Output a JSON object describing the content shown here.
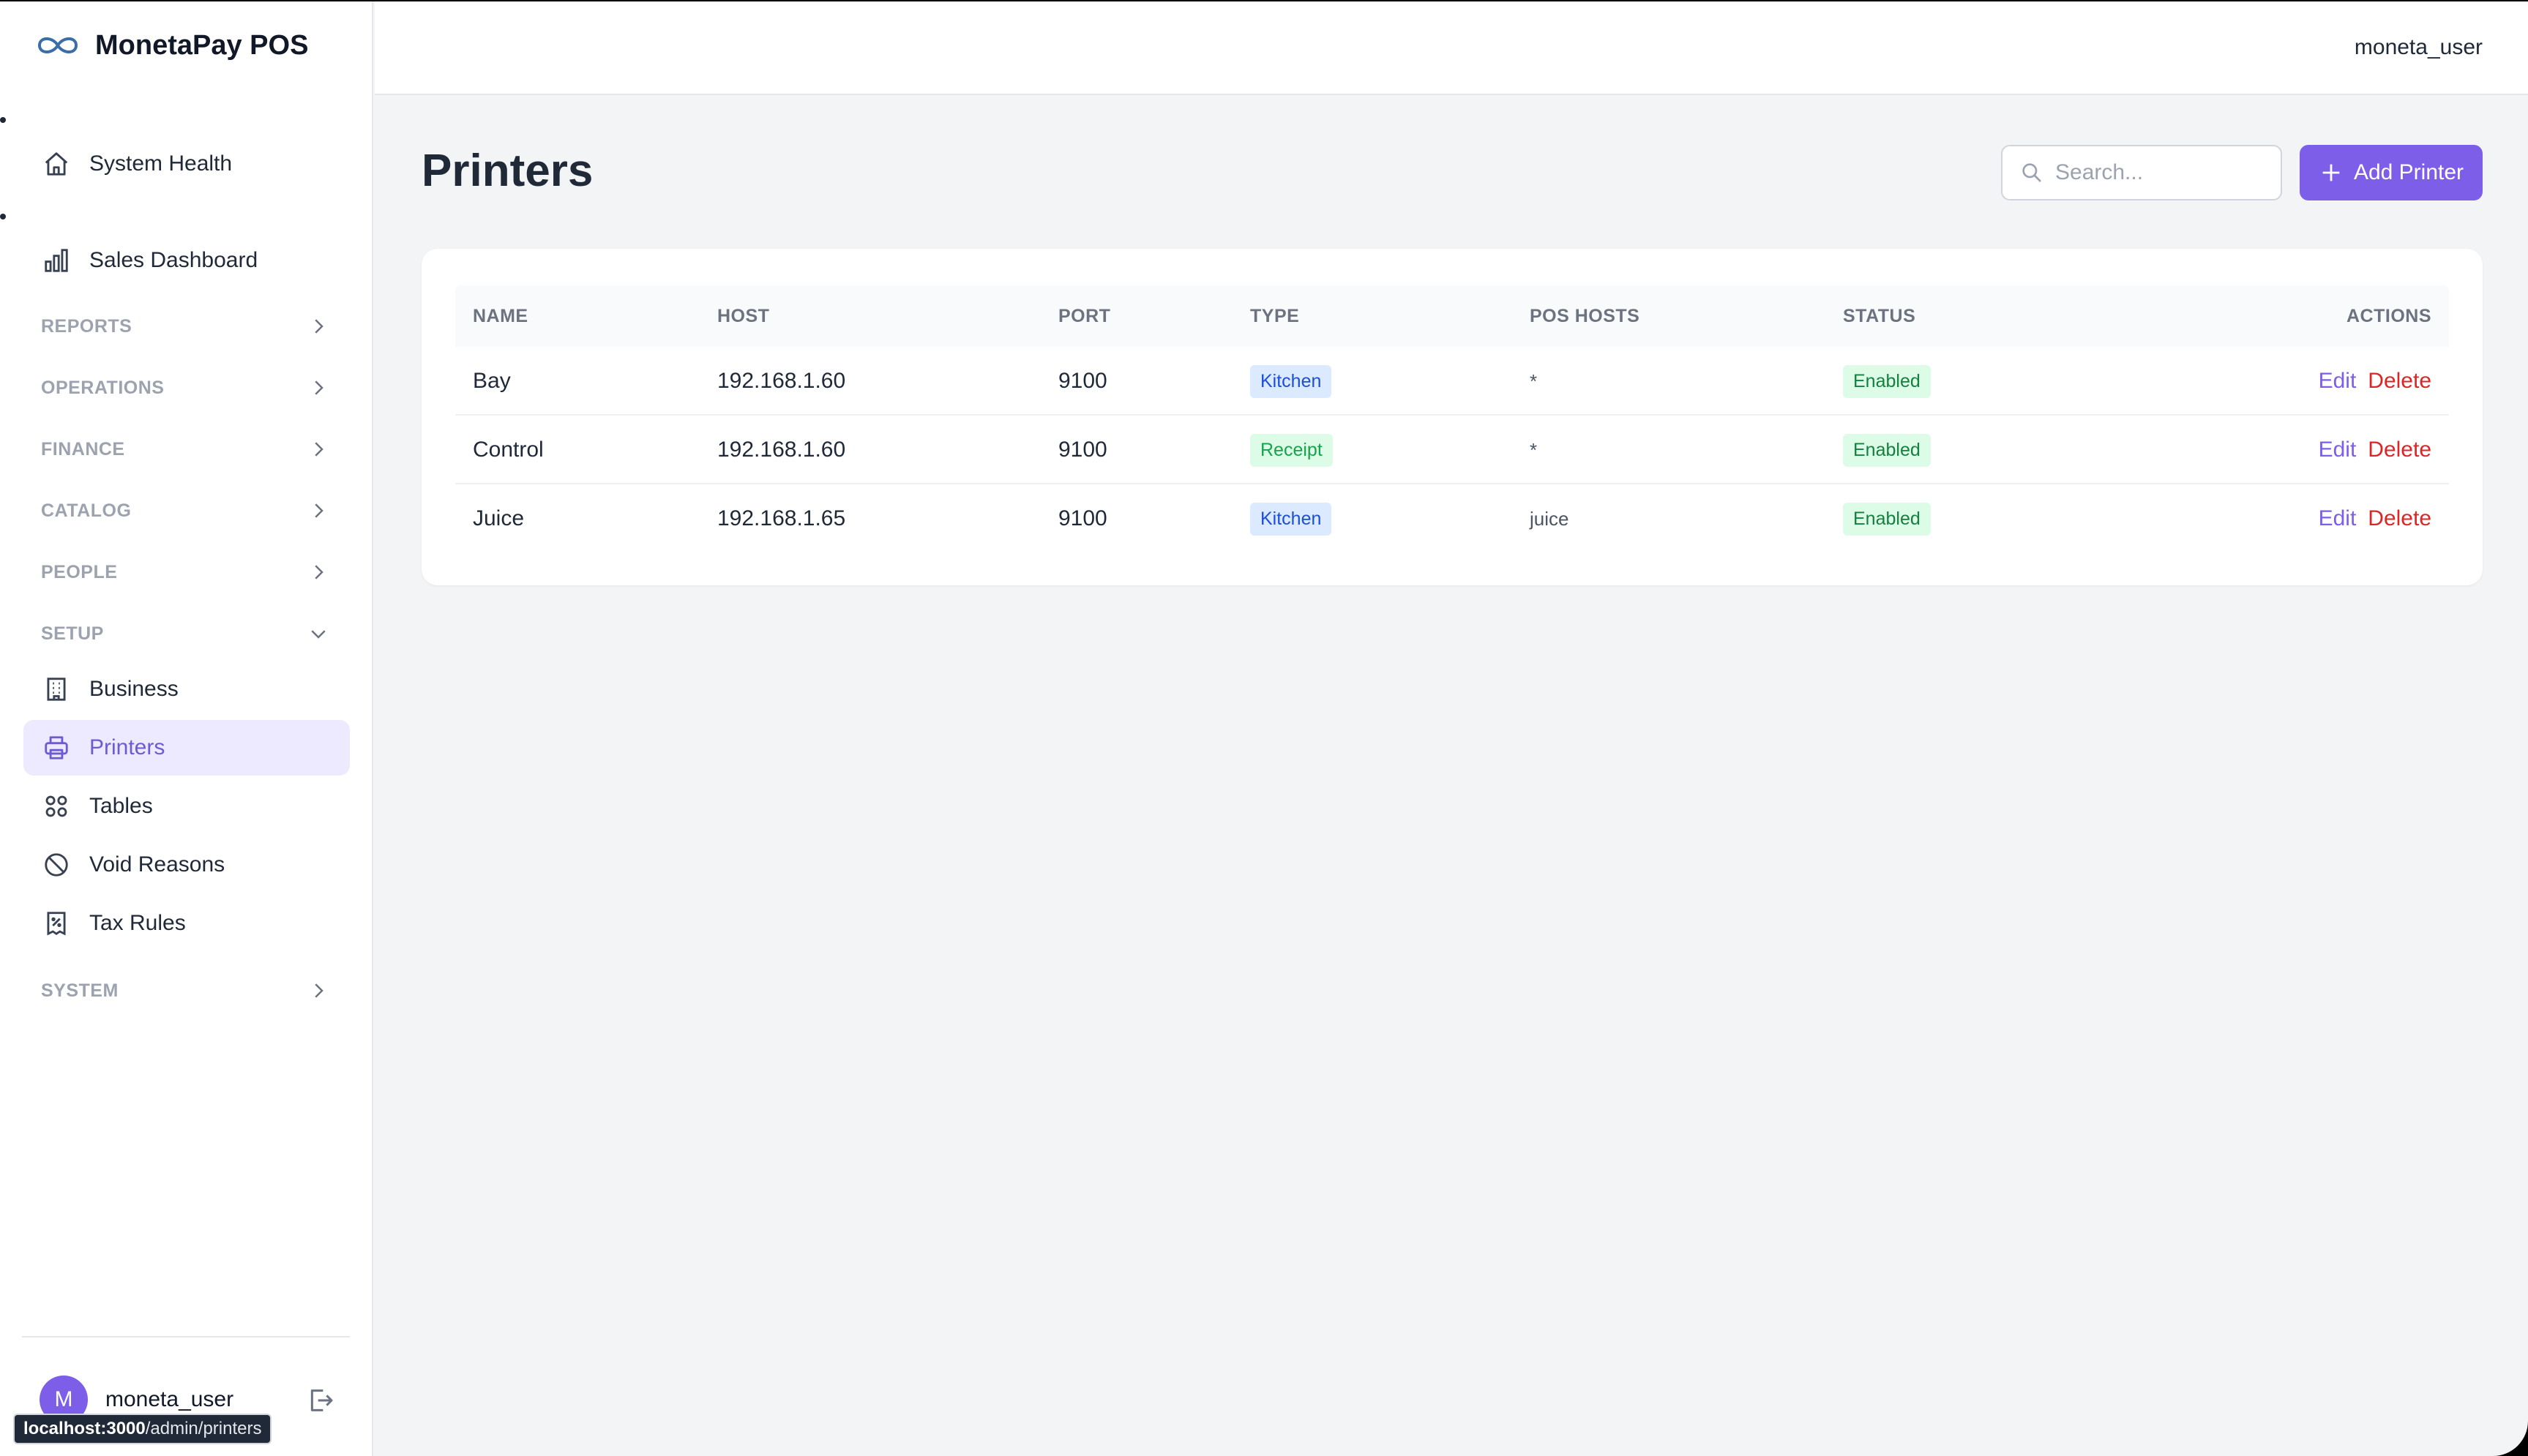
{
  "app": {
    "name": "MonetaPay POS"
  },
  "sidebar": {
    "top_items": [
      {
        "label": "System Health",
        "icon": "home-icon"
      },
      {
        "label": "Sales Dashboard",
        "icon": "bar-chart-icon"
      }
    ],
    "sections": {
      "reports": "REPORTS",
      "operations": "OPERATIONS",
      "finance": "FINANCE",
      "catalog": "CATALOG",
      "people": "PEOPLE",
      "setup": "SETUP",
      "system": "SYSTEM"
    },
    "setup_items": [
      {
        "label": "Business",
        "icon": "building-icon"
      },
      {
        "label": "Printers",
        "icon": "printer-icon",
        "active": true
      },
      {
        "label": "Tables",
        "icon": "grid-icon"
      },
      {
        "label": "Void Reasons",
        "icon": "ban-icon"
      },
      {
        "label": "Tax Rules",
        "icon": "receipt-icon"
      }
    ],
    "user": {
      "initial": "M",
      "name": "moneta_user"
    }
  },
  "status_url": {
    "host": "localhost:3000",
    "path": "/admin/printers"
  },
  "header": {
    "user": "moneta_user"
  },
  "main": {
    "title": "Printers",
    "search_placeholder": "Search...",
    "add_button": "Add Printer"
  },
  "table": {
    "columns": {
      "name": "NAME",
      "host": "HOST",
      "port": "PORT",
      "type": "TYPE",
      "pos_hosts": "POS HOSTS",
      "status": "STATUS",
      "actions": "ACTIONS"
    },
    "rows": [
      {
        "name": "Bay",
        "host": "192.168.1.60",
        "port": "9100",
        "type": "Kitchen",
        "pos_hosts": "*",
        "status": "Enabled",
        "edit": "Edit",
        "delete": "Delete"
      },
      {
        "name": "Control",
        "host": "192.168.1.60",
        "port": "9100",
        "type": "Receipt",
        "pos_hosts": "*",
        "status": "Enabled",
        "edit": "Edit",
        "delete": "Delete"
      },
      {
        "name": "Juice",
        "host": "192.168.1.65",
        "port": "9100",
        "type": "Kitchen",
        "pos_hosts": "juice",
        "status": "Enabled",
        "edit": "Edit",
        "delete": "Delete"
      }
    ]
  },
  "colors": {
    "accent": "#7c5ee8",
    "active_bg": "#ede9fe",
    "kitchen_badge": "#dbeafe",
    "enabled_badge": "#dcfce7",
    "delete": "#dc2626"
  }
}
